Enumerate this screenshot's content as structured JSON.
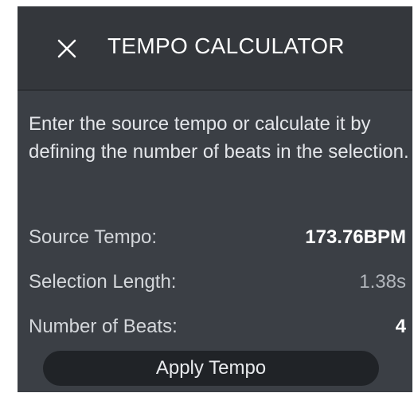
{
  "header": {
    "title": "TEMPO CALCULATOR",
    "close_icon": "close-icon"
  },
  "description": "Enter the source tempo or calculate it by defining the number of beats in the selection.",
  "fields": {
    "source_tempo": {
      "label": "Source Tempo:",
      "value": "173.76BPM"
    },
    "selection_length": {
      "label": "Selection Length:",
      "value": "1.38s"
    },
    "number_of_beats": {
      "label": "Number of Beats:",
      "value": "4"
    }
  },
  "apply_button": {
    "label": "Apply Tempo"
  },
  "colors": {
    "panel_bg": "#3b3f45",
    "header_bg": "#34373c",
    "button_bg": "#202327",
    "text": "#dde0e4",
    "muted_value": "#b2b6bc"
  }
}
